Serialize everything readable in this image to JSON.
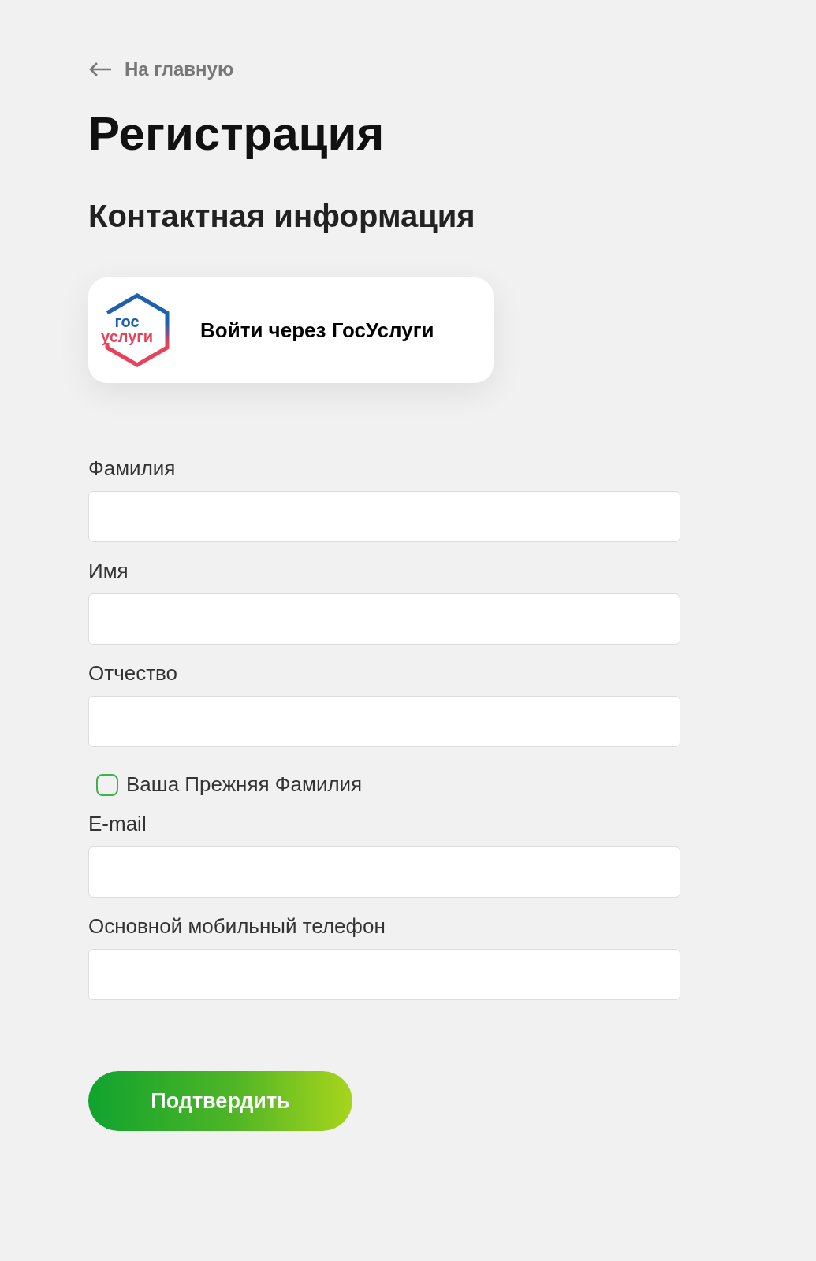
{
  "back_link": {
    "label": "На главную"
  },
  "title": "Регистрация",
  "section_title": "Контактная информация",
  "gosuslugi_button": {
    "logo_lines": [
      "гос",
      "услуги"
    ],
    "label": "Войти через ГосУслуги"
  },
  "fields": [
    {
      "kind": "input",
      "label": "Фамилия"
    },
    {
      "kind": "input",
      "label": "Имя"
    },
    {
      "kind": "input",
      "label": "Отчество"
    },
    {
      "kind": "checkbox",
      "label": "Ваша Прежняя Фамилия",
      "checked": false
    },
    {
      "kind": "input",
      "label": "E-mail"
    },
    {
      "kind": "input",
      "label": "Основной мобильный телефон"
    }
  ],
  "submit_button": "Подтвердить"
}
